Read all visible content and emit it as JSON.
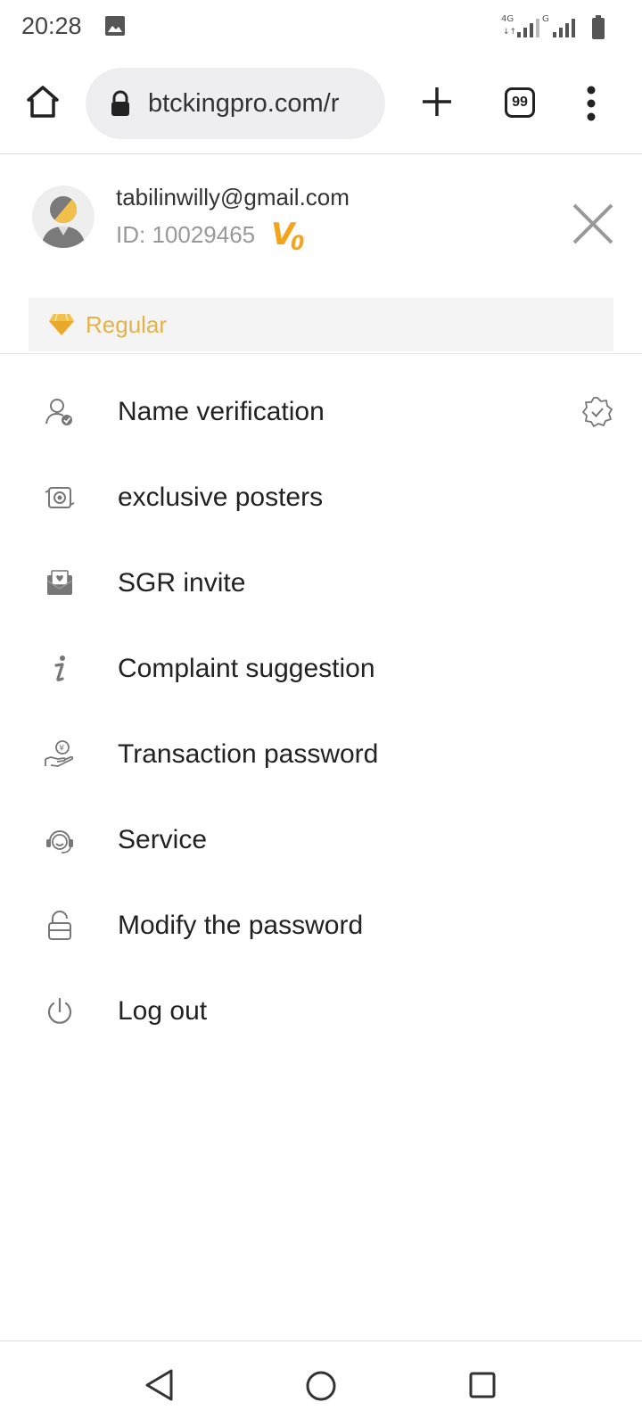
{
  "status_bar": {
    "time": "20:28",
    "network_left": "4G",
    "network_right": "G",
    "image_icon": "image-icon",
    "battery_icon": "battery-icon"
  },
  "browser": {
    "url": "btckingpro.com/r",
    "tab_count": "99",
    "icons": [
      "home-icon",
      "lock-icon",
      "plus-icon",
      "tabs-icon",
      "more-vert-icon"
    ]
  },
  "profile": {
    "email": "tabilinwilly@gmail.com",
    "id_text": "ID: 10029465",
    "vip_level": "V0",
    "tier": "Regular",
    "colors": {
      "accent": "#f5a31a",
      "tier": "#e3b34a"
    }
  },
  "menu": {
    "items": [
      {
        "label": "Name verification",
        "icon": "user-check-icon"
      },
      {
        "label": "exclusive posters",
        "icon": "poster-icon"
      },
      {
        "label": "SGR invite",
        "icon": "invite-envelope-icon"
      },
      {
        "label": "Complaint suggestion",
        "icon": "info-icon"
      },
      {
        "label": "Transaction password",
        "icon": "hand-coin-icon"
      },
      {
        "label": "Service",
        "icon": "headset-icon"
      },
      {
        "label": "Modify the password",
        "icon": "unlock-icon"
      },
      {
        "label": "Log out",
        "icon": "power-icon"
      }
    ]
  },
  "nav": {
    "icons": [
      "back-icon",
      "home-circle-icon",
      "recent-apps-icon"
    ]
  }
}
